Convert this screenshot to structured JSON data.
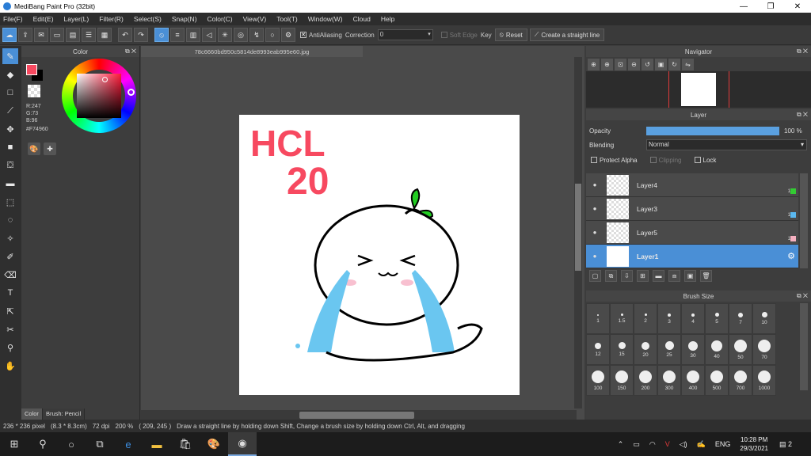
{
  "window": {
    "title": "MediBang Paint Pro (32bit)",
    "minimize": "—",
    "maximize": "❐",
    "close": "✕"
  },
  "menu": [
    "File(F)",
    "Edit(E)",
    "Layer(L)",
    "Filter(R)",
    "Select(S)",
    "Snap(N)",
    "Color(C)",
    "View(V)",
    "Tool(T)",
    "Window(W)",
    "Cloud",
    "Help"
  ],
  "toolbar": {
    "antialiasing_label": "AntiAliasing",
    "correction_label": "Correction",
    "correction_value": "0",
    "soft_edge_label": "Soft Edge",
    "key_label": "Key",
    "reset_label": "Reset",
    "straight_line_label": "Create a straight line"
  },
  "color_panel": {
    "title": "Color",
    "r": "R:247",
    "g": "G:73",
    "b": "B:96",
    "hex": "#F74960",
    "fg_color": "#f74960",
    "tab_color": "Color",
    "tab_brush": "Brush: Pencil"
  },
  "document": {
    "tab_name": "78c6660bd950c5814de8993eab995e60.jpg",
    "drawing_text_line1": "HCL",
    "drawing_text_line2": "20"
  },
  "navigator": {
    "title": "Navigator"
  },
  "layer_panel": {
    "title": "Layer",
    "opacity_label": "Opacity",
    "opacity_value": "100 %",
    "opacity_fraction": 1.0,
    "blending_label": "Blending",
    "blending_value": "Normal",
    "protect_alpha": "Protect Alpha",
    "clipping": "Clipping",
    "lock": "Lock",
    "layers": [
      {
        "name": "Layer4",
        "num": "1",
        "color": "#33cc33"
      },
      {
        "name": "Layer3",
        "num": "1",
        "color": "#5ab8f0"
      },
      {
        "name": "Layer5",
        "num": "1",
        "color": "#f5b0c0"
      },
      {
        "name": "Layer1",
        "num": "",
        "color": ""
      }
    ]
  },
  "brush_size": {
    "title": "Brush Size",
    "sizes": [
      "1",
      "1.5",
      "2",
      "3",
      "4",
      "5",
      "7",
      "10",
      "12",
      "15",
      "20",
      "25",
      "30",
      "40",
      "50",
      "70",
      "100",
      "150",
      "200",
      "300",
      "400",
      "500",
      "700",
      "1000"
    ]
  },
  "status": {
    "size": "236 * 236 pixel",
    "cm": "(8.3 * 8.3cm)",
    "dpi": "72 dpi",
    "zoom": "200 %",
    "coords": "( 209, 245 )",
    "hint": "Draw a straight line by holding down Shift, Change a brush size by holding down Ctrl, Alt, and dragging"
  },
  "taskbar": {
    "lang": "ENG",
    "time": "10:28 PM",
    "date": "29/3/2021",
    "notifications": "2"
  }
}
